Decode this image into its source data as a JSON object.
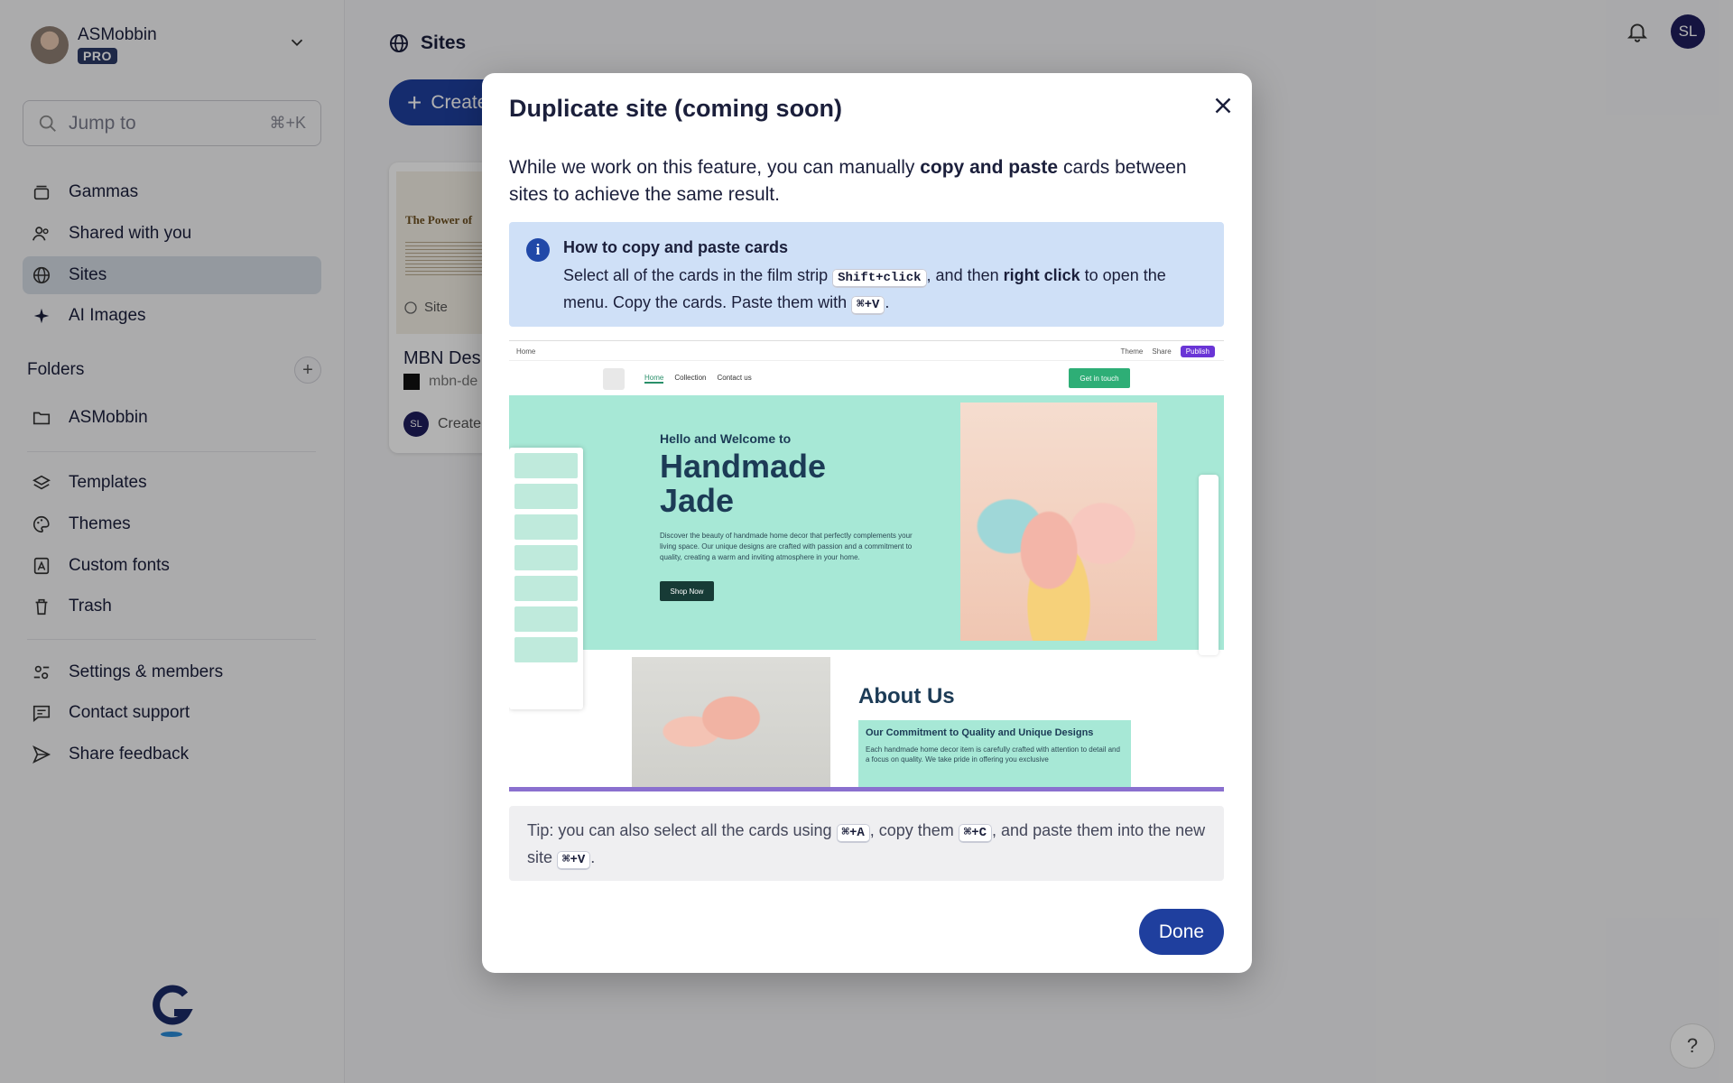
{
  "workspace": {
    "name": "ASMobbin",
    "plan": "PRO"
  },
  "search": {
    "placeholder": "Jump to",
    "shortcut": "⌘+K"
  },
  "nav": {
    "gammas": "Gammas",
    "shared": "Shared with you",
    "sites": "Sites",
    "ai_images": "AI Images"
  },
  "folders": {
    "heading": "Folders",
    "items": [
      "ASMobbin"
    ]
  },
  "nav2": {
    "templates": "Templates",
    "themes": "Themes",
    "custom_fonts": "Custom fonts",
    "trash": "Trash"
  },
  "nav3": {
    "settings": "Settings & members",
    "support": "Contact support",
    "feedback": "Share feedback"
  },
  "header": {
    "title": "Sites",
    "user_initials": "SL"
  },
  "main": {
    "create_label": "Create",
    "card": {
      "thumb_title": "The Power of",
      "tag": "Site",
      "title": "MBN Des",
      "url": "mbn-de",
      "author_initials": "SL",
      "created": "Create"
    },
    "help": "?"
  },
  "modal": {
    "title": "Duplicate site (coming soon)",
    "intro_prefix": "While we work on this feature, you can manually ",
    "intro_bold": "copy and paste",
    "intro_suffix": " cards between sites to achieve the same result.",
    "info": {
      "title": "How to copy and paste cards",
      "text1": "Select all of the cards in the film strip ",
      "key1": "Shift+click",
      "text2": ", and then ",
      "bold": "right click",
      "text3": " to open the menu. Copy the cards. Paste them with ",
      "key2": "⌘+V",
      "text4": "."
    },
    "preview": {
      "breadcrumb": "Home",
      "theme": "Theme",
      "share": "Share",
      "publish": "Publish",
      "nav_links": [
        "Home",
        "Collection",
        "Contact us"
      ],
      "cta": "Get in touch",
      "hello": "Hello and Welcome to",
      "heading": "Handmade Jade",
      "description": "Discover the beauty of handmade home decor that perfectly complements your living space. Our unique designs are crafted with passion and a commitment to quality, creating a warm and inviting atmosphere in your home.",
      "shop": "Shop Now",
      "about": "About Us",
      "box_title": "Our Commitment to Quality and Unique Designs",
      "box_text": "Each handmade home decor item is carefully crafted with attention to detail and a focus on quality. We take pride in offering you exclusive"
    },
    "tip": {
      "t1": "Tip: you can also select all the cards using ",
      "k1": "⌘+A",
      "t2": ", copy them ",
      "k2": "⌘+C",
      "t3": ", and paste them into the new site ",
      "k3": "⌘+V",
      "t4": "."
    },
    "done": "Done"
  }
}
